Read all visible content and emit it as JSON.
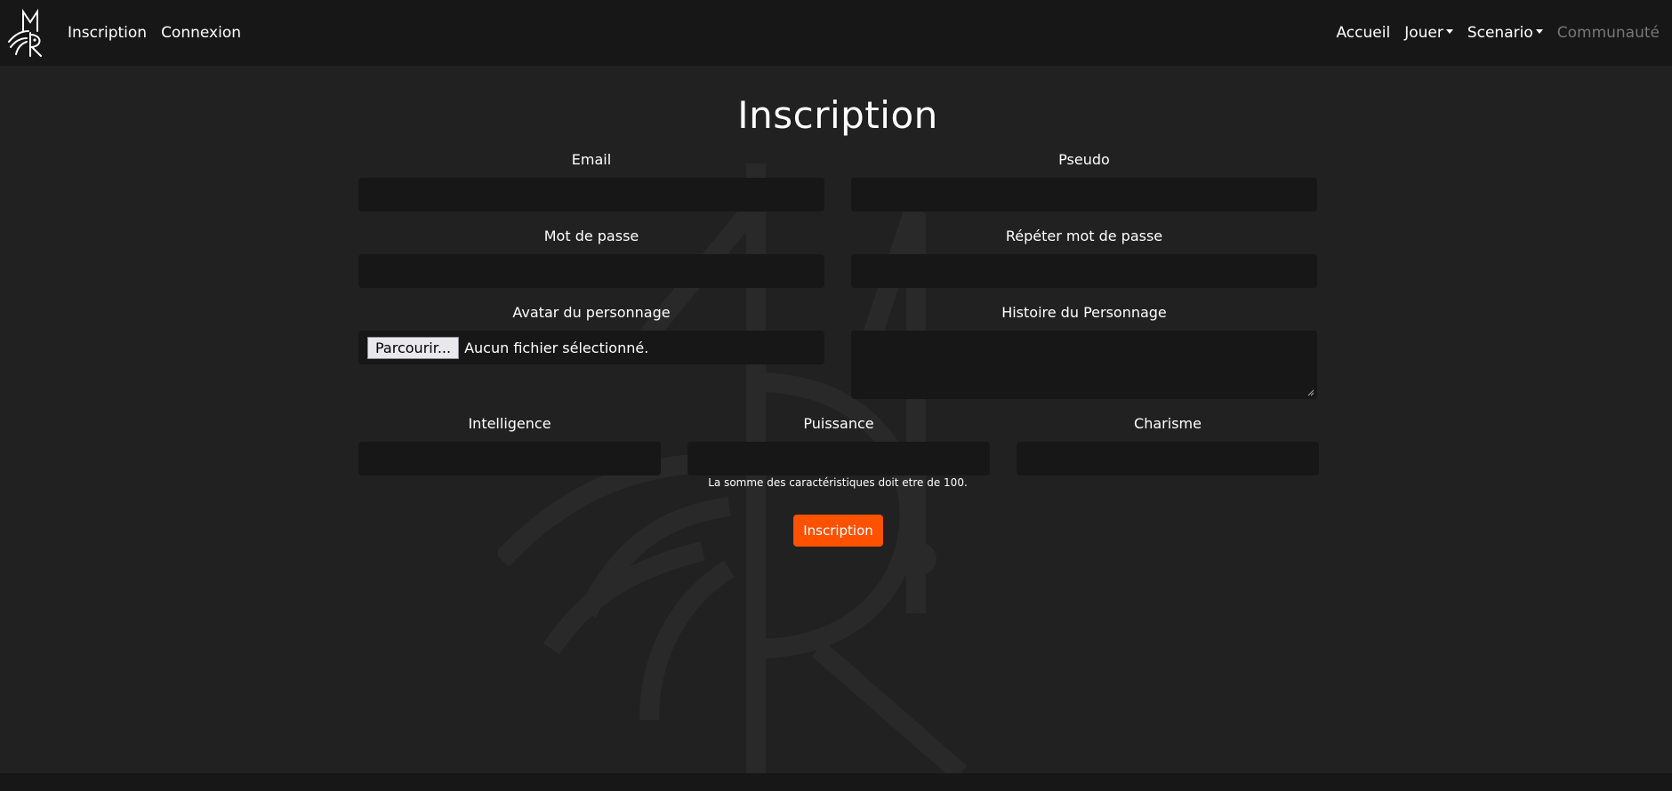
{
  "nav": {
    "left": [
      {
        "label": "Inscription"
      },
      {
        "label": "Connexion"
      }
    ],
    "right": {
      "accueil": "Accueil",
      "jouer": "Jouer",
      "scenario": "Scenario",
      "communaute": "Communauté"
    }
  },
  "page": {
    "title": "Inscription"
  },
  "form": {
    "email_label": "Email",
    "pseudo_label": "Pseudo",
    "password_label": "Mot de passe",
    "repeat_password_label": "Répéter mot de passe",
    "avatar_label": "Avatar du personnage",
    "browse_label": "Parcourir...",
    "file_status": "Aucun fichier sélectionné.",
    "story_label": "Histoire du Personnage",
    "intelligence_label": "Intelligence",
    "puissance_label": "Puissance",
    "charisme_label": "Charisme",
    "hint": "La somme des caractéristiques doit etre de 100.",
    "submit_label": "Inscription"
  },
  "colors": {
    "accent": "#ff5100",
    "background": "#212121",
    "navbar": "#171717",
    "input": "#171717"
  },
  "icons": {
    "logo": "mr-logo-icon",
    "dropdown": "caret-down-icon"
  }
}
